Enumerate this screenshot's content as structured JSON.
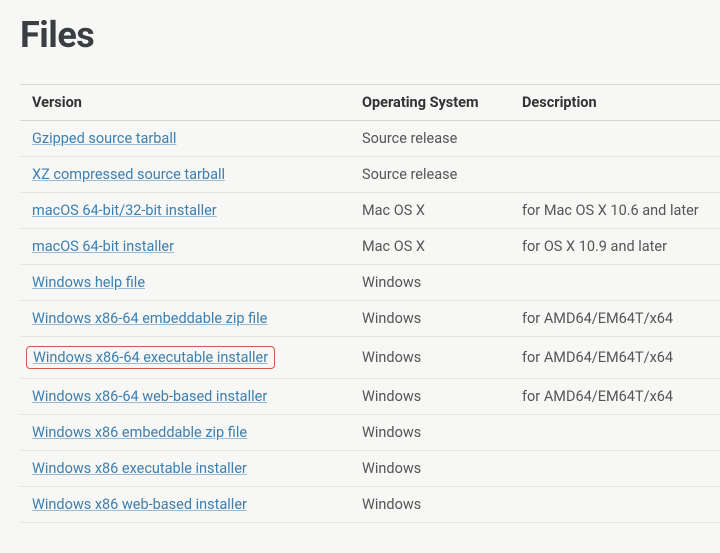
{
  "heading": "Files",
  "columns": {
    "version": "Version",
    "os": "Operating System",
    "description": "Description"
  },
  "rows": [
    {
      "version": "Gzipped source tarball",
      "os": "Source release",
      "description": "",
      "highlight": false
    },
    {
      "version": "XZ compressed source tarball",
      "os": "Source release",
      "description": "",
      "highlight": false
    },
    {
      "version": "macOS 64-bit/32-bit installer",
      "os": "Mac OS X",
      "description": "for Mac OS X 10.6 and later",
      "highlight": false
    },
    {
      "version": "macOS 64-bit installer",
      "os": "Mac OS X",
      "description": "for OS X 10.9 and later",
      "highlight": false
    },
    {
      "version": "Windows help file",
      "os": "Windows",
      "description": "",
      "highlight": false
    },
    {
      "version": "Windows x86-64 embeddable zip file",
      "os": "Windows",
      "description": "for AMD64/EM64T/x64",
      "highlight": false
    },
    {
      "version": "Windows x86-64 executable installer",
      "os": "Windows",
      "description": "for AMD64/EM64T/x64",
      "highlight": true
    },
    {
      "version": "Windows x86-64 web-based installer",
      "os": "Windows",
      "description": "for AMD64/EM64T/x64",
      "highlight": false
    },
    {
      "version": "Windows x86 embeddable zip file",
      "os": "Windows",
      "description": "",
      "highlight": false
    },
    {
      "version": "Windows x86 executable installer",
      "os": "Windows",
      "description": "",
      "highlight": false
    },
    {
      "version": "Windows x86 web-based installer",
      "os": "Windows",
      "description": "",
      "highlight": false
    }
  ]
}
